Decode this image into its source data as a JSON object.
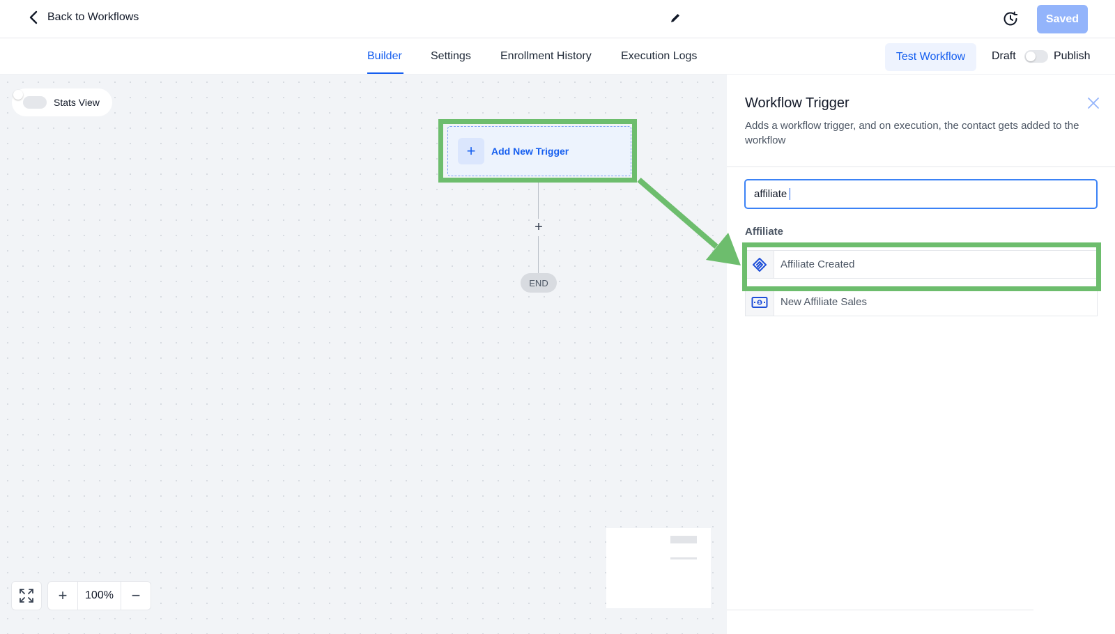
{
  "header": {
    "back_label": "Back to Workflows",
    "saved_label": "Saved"
  },
  "tabs": [
    {
      "label": "Builder",
      "active": true
    },
    {
      "label": "Settings",
      "active": false
    },
    {
      "label": "Enrollment History",
      "active": false
    },
    {
      "label": "Execution Logs",
      "active": false
    }
  ],
  "actions": {
    "test_label": "Test Workflow",
    "draft_label": "Draft",
    "publish_label": "Publish",
    "publish_toggle_on": false
  },
  "canvas": {
    "stats_label": "Stats View",
    "stats_toggle_on": false,
    "trigger_label": "Add New Trigger",
    "end_label": "END",
    "zoom_level": "100%"
  },
  "panel": {
    "title": "Workflow Trigger",
    "description": "Adds a workflow trigger, and on execution, the contact gets added to the workflow",
    "search_value": "affiliate",
    "group_label": "Affiliate",
    "options": [
      {
        "label": "Affiliate Created",
        "icon": "handshake-icon",
        "highlighted": true
      },
      {
        "label": "New Affiliate Sales",
        "icon": "dollar-bill-icon",
        "highlighted": false
      }
    ]
  },
  "colors": {
    "accent": "#155eef",
    "highlight": "#6dbd6d",
    "saved_button": "#93b4fb"
  }
}
